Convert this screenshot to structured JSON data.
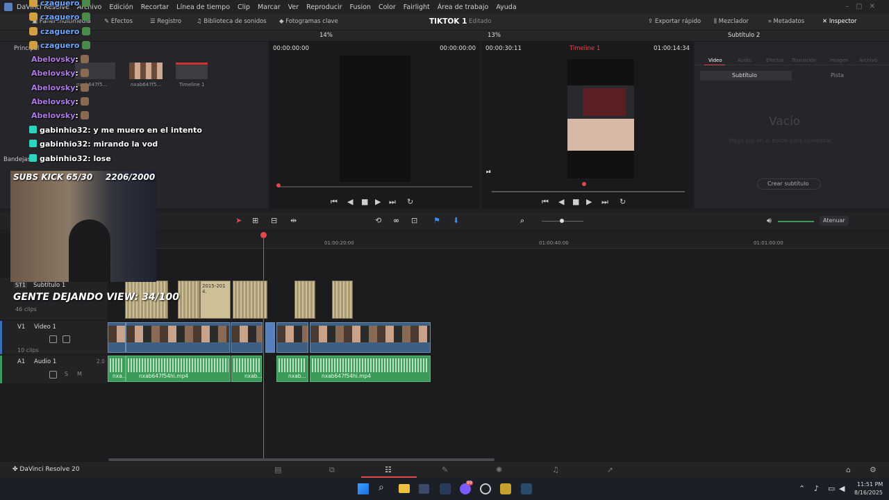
{
  "menu": {
    "app": "DaVinci Resolve",
    "items": [
      "Archivo",
      "Edición",
      "Recortar",
      "Línea de tiempo",
      "Clip",
      "Marcar",
      "Ver",
      "Reproducir",
      "Fusion",
      "Color",
      "Fairlight",
      "Área de trabajo",
      "Ayuda"
    ]
  },
  "toolbar": {
    "media_pool": "Panel multimedia",
    "effects": "Efectos",
    "index": "Registro",
    "sound_library": "Biblioteca de sonidos",
    "keyframes": "Fotogramas clave",
    "project_title": "TIKTOK 1",
    "project_status": "Editado",
    "quick_export": "Exportar rápido",
    "mixer": "Mezclador",
    "metadata": "Metadatos",
    "inspector": "Inspector"
  },
  "subbar": {
    "zoom_left": "14%",
    "zoom_right": "13%",
    "inspector_title": "Subtítulo 2"
  },
  "media_pool": {
    "bins_label": "Principal",
    "bin_panel": "Bandejas",
    "clips": [
      {
        "name": "nxab647f5..."
      },
      {
        "name": "nxab647f5..."
      },
      {
        "name": "Timeline 1"
      }
    ]
  },
  "source_viewer": {
    "tc_left": "00:00:00:00",
    "tc_right": "00:00:00:00"
  },
  "timeline_viewer": {
    "tc_left": "00:00:30:11",
    "timeline_name": "Timeline 1",
    "tc_right": "01:00:14:34"
  },
  "inspector": {
    "tabs": [
      "Video",
      "Audio",
      "Efectos",
      "Transición",
      "Imagen",
      "Archivo"
    ],
    "subtabs": [
      "Subtítulo",
      "Pista"
    ],
    "empty_title": "Vacío",
    "empty_hint": "Haga clic en el botón para comenzar.",
    "create_button": "Crear subtítulo"
  },
  "timeline": {
    "attenuate": "Atenuar",
    "ruler": [
      "01:00:20:00",
      "01:00:40:00",
      "01:01:00:00"
    ],
    "subtitle_track": {
      "id": "ST1",
      "name": "Subtítulo 1",
      "count": "46 clips",
      "clip_text": "2015-201 4."
    },
    "video_track": {
      "id": "V1",
      "name": "Video 1",
      "count": "10 clips"
    },
    "audio_track": {
      "id": "A1",
      "name": "Audio 1",
      "level": "2.0",
      "solo": "S",
      "mute": "M"
    },
    "audio_clips": [
      "nxa...",
      "nxab647f54hi.mp4",
      "nxab...",
      "nxab...",
      "nxab647f54hi.mp4"
    ]
  },
  "overlay": {
    "subs_kick": "SUBS KICK 65/30",
    "counter": "2206/2000",
    "gente": "GENTE DEJANDO VIEW: 34/100",
    "chat": [
      {
        "user": "czaguero",
        "text": ""
      },
      {
        "user": "czaguero",
        "text": ""
      },
      {
        "user": "czaguero",
        "text": ""
      },
      {
        "user": "czaguero",
        "text": ""
      },
      {
        "user": "Abelovsky",
        "text": ":"
      },
      {
        "user": "Abelovsky",
        "text": ":"
      },
      {
        "user": "Abelovsky",
        "text": ":"
      },
      {
        "user": "Abelovsky",
        "text": ":"
      },
      {
        "user": "Abelovsky",
        "text": ":"
      },
      {
        "user": "gabinhio32",
        "text": ": y me muero en el intento"
      },
      {
        "user": "gabinhio32",
        "text": ": mirando la vod"
      },
      {
        "user": "gabinhio32",
        "text": ": lose"
      }
    ]
  },
  "bottom": {
    "app_label": "DaVinci Resolve 20"
  },
  "taskbar": {
    "time": "11:51 PM",
    "date": "8/16/2025",
    "badge": "99"
  },
  "colors": {
    "accent_red": "#e0484c",
    "video_clip": "#3d5f84",
    "audio_clip": "#3c9a5a"
  }
}
